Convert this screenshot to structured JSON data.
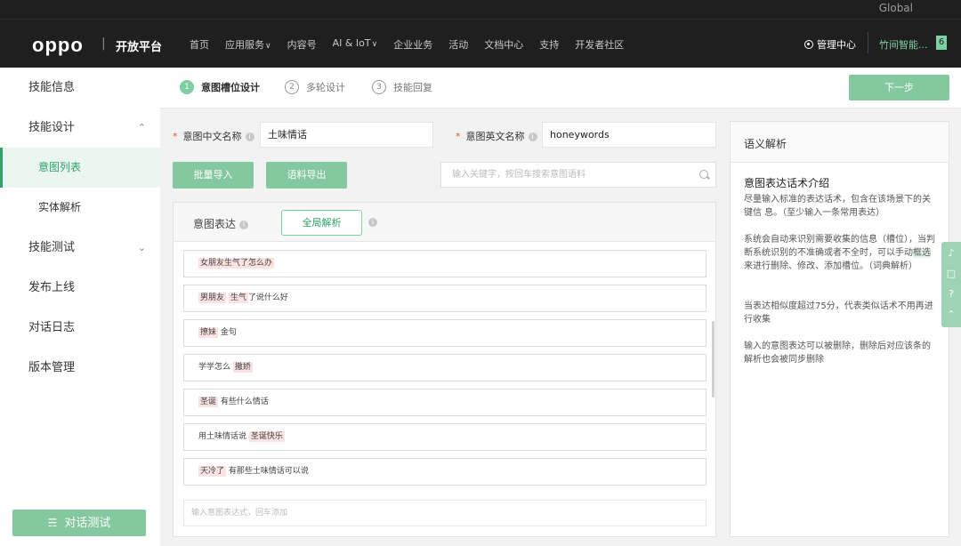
{
  "topbar": {
    "region": "Global"
  },
  "header": {
    "logo": "oppo",
    "separator": "|",
    "platform": "开放平台",
    "nav": [
      {
        "label": "首页",
        "dropdown": false
      },
      {
        "label": "应用服务",
        "dropdown": true
      },
      {
        "label": "内容号",
        "dropdown": false
      },
      {
        "label": "AI & IoT",
        "dropdown": true
      },
      {
        "label": "企业业务",
        "dropdown": false
      },
      {
        "label": "活动",
        "dropdown": false
      },
      {
        "label": "文档中心",
        "dropdown": false
      },
      {
        "label": "支持",
        "dropdown": false
      },
      {
        "label": "开发者社区",
        "dropdown": false
      }
    ],
    "manage": "管理中心",
    "user": "竹间智能...",
    "badge": "6"
  },
  "sidebar": {
    "items": [
      {
        "label": "技能信息"
      },
      {
        "label": "技能设计",
        "chevron": "up"
      },
      {
        "label": "意图列表",
        "sub": true,
        "active": true
      },
      {
        "label": "实体解析",
        "sub": true
      },
      {
        "label": "技能测试",
        "chevron": "down"
      },
      {
        "label": "发布上线"
      },
      {
        "label": "对话日志"
      },
      {
        "label": "版本管理"
      }
    ],
    "test_button": "对话测试"
  },
  "steps": [
    {
      "num": "1",
      "label": "意图槽位设计",
      "active": true
    },
    {
      "num": "2",
      "label": "多轮设计"
    },
    {
      "num": "3",
      "label": "技能回复"
    }
  ],
  "next_button": "下一步",
  "form": {
    "cn_name_label": "意图中文名称",
    "cn_name_value": "土味情话",
    "en_name_label": "意图英文名称",
    "en_name_value": "honeywords",
    "import_button": "批量导入",
    "export_button": "语料导出",
    "search_placeholder": "输入关键字，按回车搜索意图语料"
  },
  "expressions": {
    "title": "意图表达",
    "global_parse_button": "全局解析",
    "rows": [
      [
        {
          "t": "女朋友生气了怎么办",
          "h": true
        }
      ],
      [
        {
          "t": "男朋友",
          "h": true
        },
        {
          "t": " "
        },
        {
          "t": "生气",
          "h": true
        },
        {
          "t": "了说什么好"
        }
      ],
      [
        {
          "t": "撩妹",
          "h": true
        },
        {
          "t": " 金句"
        }
      ],
      [
        {
          "t": "学学怎么 "
        },
        {
          "t": "撒娇",
          "h": true
        }
      ],
      [
        {
          "t": "圣诞",
          "h": true
        },
        {
          "t": " 有些什么情话"
        }
      ],
      [
        {
          "t": "用土味情话说 "
        },
        {
          "t": "圣诞快乐",
          "h": true
        }
      ],
      [
        {
          "t": "天冷了",
          "h": true
        },
        {
          "t": " 有那些土味情话可以说"
        }
      ]
    ],
    "add_placeholder": "输入意图表达式，回车添加"
  },
  "semantic": {
    "title": "语义解析",
    "subtitle": "意图表达话术介绍",
    "para1": "尽量输入标准的表达话术，包含在该场景下的关键信 息。（至少输入一条常用表达）",
    "para2_pre": "系统会自动来识别需要收集的信息（槽位），当判断系统识别的不准确或者不全时，可以手动",
    "para2_hl": "框选",
    "para2_post": "来进行删除、修改、添加槽位。（词典解析）",
    "para3": "当表达相似度超过75分，代表类似话术不用再进行收集",
    "para4": "输入的意图表达可以被删除，删除后对应该条的解析也会被同步删除"
  },
  "float_tools": [
    "headset-icon",
    "message-icon",
    "help-icon",
    "back-to-top-icon"
  ]
}
